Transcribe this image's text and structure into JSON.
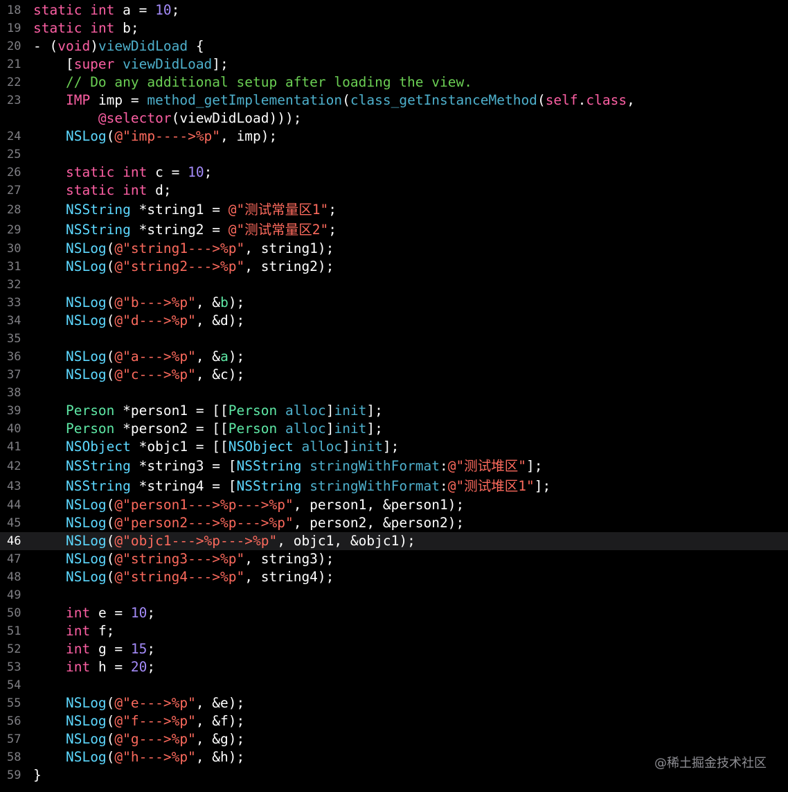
{
  "colors": {
    "background": "#000000",
    "keyword": "#fc5fa3",
    "number": "#a48bf9",
    "string": "#fc6a5d",
    "comment": "#6bcf54",
    "type": "#5dd8ff",
    "class": "#5ee8a5",
    "method": "#4eb0cc",
    "line_number": "#7f7f84",
    "current_line": "#1c1c1e"
  },
  "current_line": "46",
  "watermark": "@稀土掘金技术社区",
  "lines": [
    {
      "n": "18",
      "tokens": [
        [
          "kw",
          "static"
        ],
        [
          "plain",
          " "
        ],
        [
          "kw",
          "int"
        ],
        [
          "plain",
          " a = "
        ],
        [
          "num",
          "10"
        ],
        [
          "plain",
          ";"
        ]
      ]
    },
    {
      "n": "19",
      "tokens": [
        [
          "kw",
          "static"
        ],
        [
          "plain",
          " "
        ],
        [
          "kw",
          "int"
        ],
        [
          "plain",
          " b;"
        ]
      ]
    },
    {
      "n": "20",
      "tokens": [
        [
          "plain",
          "- ("
        ],
        [
          "kw",
          "void"
        ],
        [
          "plain",
          ")"
        ],
        [
          "method",
          "viewDidLoad"
        ],
        [
          "plain",
          " {"
        ]
      ]
    },
    {
      "n": "21",
      "tokens": [
        [
          "plain",
          "    ["
        ],
        [
          "kw",
          "super"
        ],
        [
          "plain",
          " "
        ],
        [
          "method",
          "viewDidLoad"
        ],
        [
          "plain",
          "];"
        ]
      ]
    },
    {
      "n": "22",
      "tokens": [
        [
          "plain",
          "    "
        ],
        [
          "cmt",
          "// Do any additional setup after loading the view."
        ]
      ]
    },
    {
      "n": "23",
      "wrap": true,
      "tokens": [
        [
          "plain",
          "    "
        ],
        [
          "kw",
          "IMP"
        ],
        [
          "plain",
          " imp = "
        ],
        [
          "func",
          "method_getImplementation"
        ],
        [
          "plain",
          "("
        ],
        [
          "func",
          "class_getInstanceMethod"
        ],
        [
          "plain",
          "("
        ],
        [
          "kw",
          "self"
        ],
        [
          "plain",
          "."
        ],
        [
          "kw",
          "class"
        ],
        [
          "plain",
          ",\n        "
        ],
        [
          "kw",
          "@selector"
        ],
        [
          "plain",
          "(viewDidLoad)));"
        ]
      ]
    },
    {
      "n": "24",
      "tokens": [
        [
          "plain",
          "    "
        ],
        [
          "type",
          "NSLog"
        ],
        [
          "plain",
          "("
        ],
        [
          "str",
          "@\"imp---->%p\""
        ],
        [
          "plain",
          ", imp);"
        ]
      ]
    },
    {
      "n": "25",
      "tokens": []
    },
    {
      "n": "26",
      "tokens": [
        [
          "plain",
          "    "
        ],
        [
          "kw",
          "static"
        ],
        [
          "plain",
          " "
        ],
        [
          "kw",
          "int"
        ],
        [
          "plain",
          " c = "
        ],
        [
          "num",
          "10"
        ],
        [
          "plain",
          ";"
        ]
      ]
    },
    {
      "n": "27",
      "tokens": [
        [
          "plain",
          "    "
        ],
        [
          "kw",
          "static"
        ],
        [
          "plain",
          " "
        ],
        [
          "kw",
          "int"
        ],
        [
          "plain",
          " d;"
        ]
      ]
    },
    {
      "n": "28",
      "tall": true,
      "tokens": [
        [
          "plain",
          "    "
        ],
        [
          "type",
          "NSString"
        ],
        [
          "plain",
          " *string1 = "
        ],
        [
          "str",
          "@\"测试常量区1\""
        ],
        [
          "plain",
          ";"
        ]
      ]
    },
    {
      "n": "29",
      "tall": true,
      "tokens": [
        [
          "plain",
          "    "
        ],
        [
          "type",
          "NSString"
        ],
        [
          "plain",
          " *string2 = "
        ],
        [
          "str",
          "@\"测试常量区2\""
        ],
        [
          "plain",
          ";"
        ]
      ]
    },
    {
      "n": "30",
      "tokens": [
        [
          "plain",
          "    "
        ],
        [
          "type",
          "NSLog"
        ],
        [
          "plain",
          "("
        ],
        [
          "str",
          "@\"string1--->%p\""
        ],
        [
          "plain",
          ", string1);"
        ]
      ]
    },
    {
      "n": "31",
      "tokens": [
        [
          "plain",
          "    "
        ],
        [
          "type",
          "NSLog"
        ],
        [
          "plain",
          "("
        ],
        [
          "str",
          "@\"string2--->%p\""
        ],
        [
          "plain",
          ", string2);"
        ]
      ]
    },
    {
      "n": "32",
      "tokens": []
    },
    {
      "n": "33",
      "tokens": [
        [
          "plain",
          "    "
        ],
        [
          "type",
          "NSLog"
        ],
        [
          "plain",
          "("
        ],
        [
          "str",
          "@\"b--->%p\""
        ],
        [
          "plain",
          ", &"
        ],
        [
          "var",
          "b"
        ],
        [
          "plain",
          ");"
        ]
      ]
    },
    {
      "n": "34",
      "tokens": [
        [
          "plain",
          "    "
        ],
        [
          "type",
          "NSLog"
        ],
        [
          "plain",
          "("
        ],
        [
          "str",
          "@\"d--->%p\""
        ],
        [
          "plain",
          ", &d);"
        ]
      ]
    },
    {
      "n": "35",
      "tokens": []
    },
    {
      "n": "36",
      "tokens": [
        [
          "plain",
          "    "
        ],
        [
          "type",
          "NSLog"
        ],
        [
          "plain",
          "("
        ],
        [
          "str",
          "@\"a--->%p\""
        ],
        [
          "plain",
          ", &"
        ],
        [
          "var",
          "a"
        ],
        [
          "plain",
          ");"
        ]
      ]
    },
    {
      "n": "37",
      "tokens": [
        [
          "plain",
          "    "
        ],
        [
          "type",
          "NSLog"
        ],
        [
          "plain",
          "("
        ],
        [
          "str",
          "@\"c--->%p\""
        ],
        [
          "plain",
          ", &c);"
        ]
      ]
    },
    {
      "n": "38",
      "tokens": []
    },
    {
      "n": "39",
      "tokens": [
        [
          "plain",
          "    "
        ],
        [
          "cls",
          "Person"
        ],
        [
          "plain",
          " *person1 = [["
        ],
        [
          "cls",
          "Person"
        ],
        [
          "plain",
          " "
        ],
        [
          "method",
          "alloc"
        ],
        [
          "plain",
          "]"
        ],
        [
          "method",
          "init"
        ],
        [
          "plain",
          "];"
        ]
      ]
    },
    {
      "n": "40",
      "tokens": [
        [
          "plain",
          "    "
        ],
        [
          "cls",
          "Person"
        ],
        [
          "plain",
          " *person2 = [["
        ],
        [
          "cls",
          "Person"
        ],
        [
          "plain",
          " "
        ],
        [
          "method",
          "alloc"
        ],
        [
          "plain",
          "]"
        ],
        [
          "method",
          "init"
        ],
        [
          "plain",
          "];"
        ]
      ]
    },
    {
      "n": "41",
      "tokens": [
        [
          "plain",
          "    "
        ],
        [
          "type",
          "NSObject"
        ],
        [
          "plain",
          " *objc1 = [["
        ],
        [
          "type",
          "NSObject"
        ],
        [
          "plain",
          " "
        ],
        [
          "method",
          "alloc"
        ],
        [
          "plain",
          "]"
        ],
        [
          "method",
          "init"
        ],
        [
          "plain",
          "];"
        ]
      ]
    },
    {
      "n": "42",
      "tall": true,
      "tokens": [
        [
          "plain",
          "    "
        ],
        [
          "type",
          "NSString"
        ],
        [
          "plain",
          " *string3 = ["
        ],
        [
          "type",
          "NSString"
        ],
        [
          "plain",
          " "
        ],
        [
          "method",
          "stringWithFormat"
        ],
        [
          "plain",
          ":"
        ],
        [
          "str",
          "@\"测试堆区\""
        ],
        [
          "plain",
          "];"
        ]
      ]
    },
    {
      "n": "43",
      "tall": true,
      "tokens": [
        [
          "plain",
          "    "
        ],
        [
          "type",
          "NSString"
        ],
        [
          "plain",
          " *string4 = ["
        ],
        [
          "type",
          "NSString"
        ],
        [
          "plain",
          " "
        ],
        [
          "method",
          "stringWithFormat"
        ],
        [
          "plain",
          ":"
        ],
        [
          "str",
          "@\"测试堆区1\""
        ],
        [
          "plain",
          "];"
        ]
      ]
    },
    {
      "n": "44",
      "tokens": [
        [
          "plain",
          "    "
        ],
        [
          "type",
          "NSLog"
        ],
        [
          "plain",
          "("
        ],
        [
          "str",
          "@\"person1--->%p--->%p\""
        ],
        [
          "plain",
          ", person1, &person1);"
        ]
      ]
    },
    {
      "n": "45",
      "tokens": [
        [
          "plain",
          "    "
        ],
        [
          "type",
          "NSLog"
        ],
        [
          "plain",
          "("
        ],
        [
          "str",
          "@\"person2--->%p--->%p\""
        ],
        [
          "plain",
          ", person2, &person2);"
        ]
      ]
    },
    {
      "n": "46",
      "tokens": [
        [
          "plain",
          "    "
        ],
        [
          "type",
          "NSLog"
        ],
        [
          "plain",
          "("
        ],
        [
          "str",
          "@\"objc1--->%p--->%p\""
        ],
        [
          "plain",
          ", objc1, &objc1);"
        ]
      ]
    },
    {
      "n": "47",
      "tokens": [
        [
          "plain",
          "    "
        ],
        [
          "type",
          "NSLog"
        ],
        [
          "plain",
          "("
        ],
        [
          "str",
          "@\"string3--->%p\""
        ],
        [
          "plain",
          ", string3);"
        ]
      ]
    },
    {
      "n": "48",
      "tokens": [
        [
          "plain",
          "    "
        ],
        [
          "type",
          "NSLog"
        ],
        [
          "plain",
          "("
        ],
        [
          "str",
          "@\"string4--->%p\""
        ],
        [
          "plain",
          ", string4);"
        ]
      ]
    },
    {
      "n": "49",
      "tokens": []
    },
    {
      "n": "50",
      "tokens": [
        [
          "plain",
          "    "
        ],
        [
          "kw",
          "int"
        ],
        [
          "plain",
          " e = "
        ],
        [
          "num",
          "10"
        ],
        [
          "plain",
          ";"
        ]
      ]
    },
    {
      "n": "51",
      "tokens": [
        [
          "plain",
          "    "
        ],
        [
          "kw",
          "int"
        ],
        [
          "plain",
          " f;"
        ]
      ]
    },
    {
      "n": "52",
      "tokens": [
        [
          "plain",
          "    "
        ],
        [
          "kw",
          "int"
        ],
        [
          "plain",
          " g = "
        ],
        [
          "num",
          "15"
        ],
        [
          "plain",
          ";"
        ]
      ]
    },
    {
      "n": "53",
      "tokens": [
        [
          "plain",
          "    "
        ],
        [
          "kw",
          "int"
        ],
        [
          "plain",
          " h = "
        ],
        [
          "num",
          "20"
        ],
        [
          "plain",
          ";"
        ]
      ]
    },
    {
      "n": "54",
      "tokens": []
    },
    {
      "n": "55",
      "tokens": [
        [
          "plain",
          "    "
        ],
        [
          "type",
          "NSLog"
        ],
        [
          "plain",
          "("
        ],
        [
          "str",
          "@\"e--->%p\""
        ],
        [
          "plain",
          ", &e);"
        ]
      ]
    },
    {
      "n": "56",
      "tokens": [
        [
          "plain",
          "    "
        ],
        [
          "type",
          "NSLog"
        ],
        [
          "plain",
          "("
        ],
        [
          "str",
          "@\"f--->%p\""
        ],
        [
          "plain",
          ", &f);"
        ]
      ]
    },
    {
      "n": "57",
      "tokens": [
        [
          "plain",
          "    "
        ],
        [
          "type",
          "NSLog"
        ],
        [
          "plain",
          "("
        ],
        [
          "str",
          "@\"g--->%p\""
        ],
        [
          "plain",
          ", &g);"
        ]
      ]
    },
    {
      "n": "58",
      "tokens": [
        [
          "plain",
          "    "
        ],
        [
          "type",
          "NSLog"
        ],
        [
          "plain",
          "("
        ],
        [
          "str",
          "@\"h--->%p\""
        ],
        [
          "plain",
          ", &h);"
        ]
      ]
    },
    {
      "n": "59",
      "tokens": [
        [
          "plain",
          "}"
        ]
      ]
    }
  ]
}
